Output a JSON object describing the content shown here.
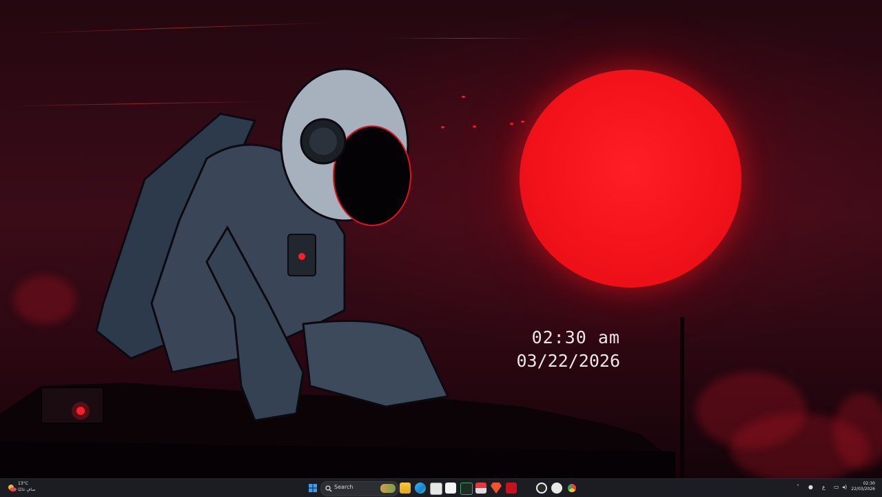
{
  "desktop": {
    "clock_widget": {
      "time": "02:30 am",
      "date": "03/22/2026"
    },
    "wallpaper": "astronaut-on-rooftop-red-sun",
    "colors": {
      "sun": "#f3121a",
      "sky_dark": "#240710",
      "sky_mid": "#3a0c18",
      "accent_red": "#e81b2a"
    }
  },
  "taskbar": {
    "weather": {
      "temperature": "13°C",
      "condition": "صافٍ غالبًا",
      "icon": "partly-cloudy-icon"
    },
    "start_icon": "windows-start-icon",
    "search_placeholder": "Search",
    "pinned_apps": [
      "widget-app-icon",
      "file-explorer-icon",
      "edge-browser-icon",
      "calendar-app-icon",
      "notepad-icon",
      "excel-icon",
      "media-app-icon",
      "brave-browser-icon",
      "acrobat-icon",
      "obs-icon",
      "steam-icon",
      "chrome-icon"
    ],
    "tray": {
      "language": "ع",
      "time": "02:30",
      "date": "22/03/2026"
    },
    "colors": {
      "background": "#1c1d22",
      "search_bg": "#2d2e33"
    }
  }
}
